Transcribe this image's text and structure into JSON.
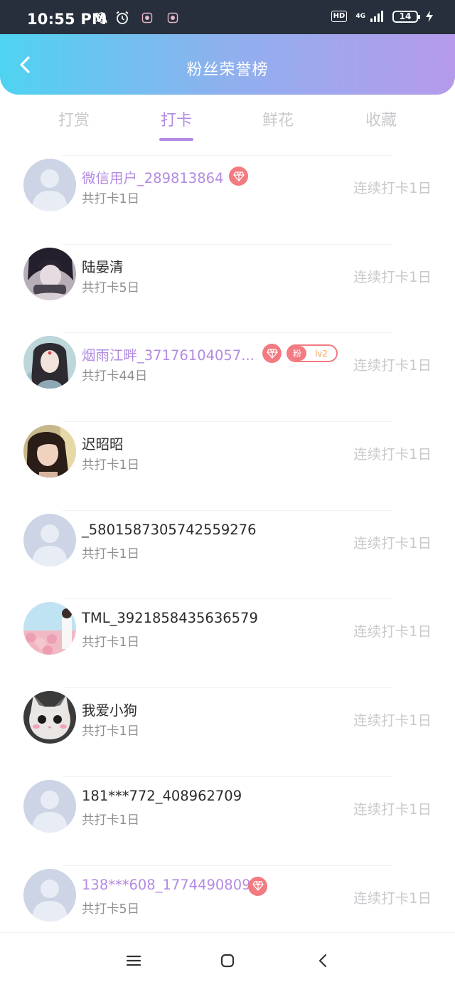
{
  "status_bar": {
    "time": "10:55 PM",
    "hd": "HD",
    "network": "4G",
    "battery": "14",
    "icons": [
      "bell-off-icon",
      "alarm-icon",
      "app-notification-icon",
      "app-notification-icon",
      "signal-icon",
      "charging-icon"
    ]
  },
  "header": {
    "title": "粉丝荣誉榜",
    "back_icon": "chevron-left-icon"
  },
  "tabs": [
    {
      "label": "打赏",
      "active": false
    },
    {
      "label": "打卡",
      "active": true
    },
    {
      "label": "鲜花",
      "active": false
    },
    {
      "label": "收藏",
      "active": false
    }
  ],
  "list": [
    {
      "name": "微信用户_289813864",
      "count": "共打卡1日",
      "streak": "连续打卡1日",
      "vip": true,
      "avatar": "default"
    },
    {
      "name": "陆晏清",
      "count": "共打卡5日",
      "streak": "连续打卡1日",
      "vip": false,
      "avatar": "photo-dark-hair"
    },
    {
      "name": "烟雨江畔_37176104057...",
      "count": "共打卡44日",
      "streak": "连续打卡1日",
      "vip": true,
      "avatar": "photo-illustrated-woman",
      "fan_badge": {
        "label": "粉",
        "level": "lv2"
      }
    },
    {
      "name": "迟昭昭",
      "count": "共打卡1日",
      "streak": "连续打卡1日",
      "vip": false,
      "avatar": "photo-girl"
    },
    {
      "name": "_5801587305742559276",
      "count": "共打卡1日",
      "streak": "连续打卡1日",
      "vip": false,
      "avatar": "default"
    },
    {
      "name": "TML_3921858435636579",
      "count": "共打卡1日",
      "streak": "连续打卡1日",
      "vip": false,
      "avatar": "photo-flowers"
    },
    {
      "name": "我爱小狗",
      "count": "共打卡1日",
      "streak": "连续打卡1日",
      "vip": false,
      "avatar": "photo-cat"
    },
    {
      "name": "181***772_408962709",
      "count": "共打卡1日",
      "streak": "连续打卡1日",
      "vip": false,
      "avatar": "default"
    },
    {
      "name": "138***608_1774490809",
      "count": "共打卡5日",
      "streak": "连续打卡1日",
      "vip": true,
      "avatar": "default"
    }
  ],
  "navbar": {
    "icons": [
      "menu-icon",
      "home-icon",
      "back-icon"
    ]
  },
  "colors": {
    "accent": "#b38be2",
    "gem": "#f27a80",
    "header_gradient": [
      "#4fd3f1",
      "#b69aec"
    ]
  }
}
